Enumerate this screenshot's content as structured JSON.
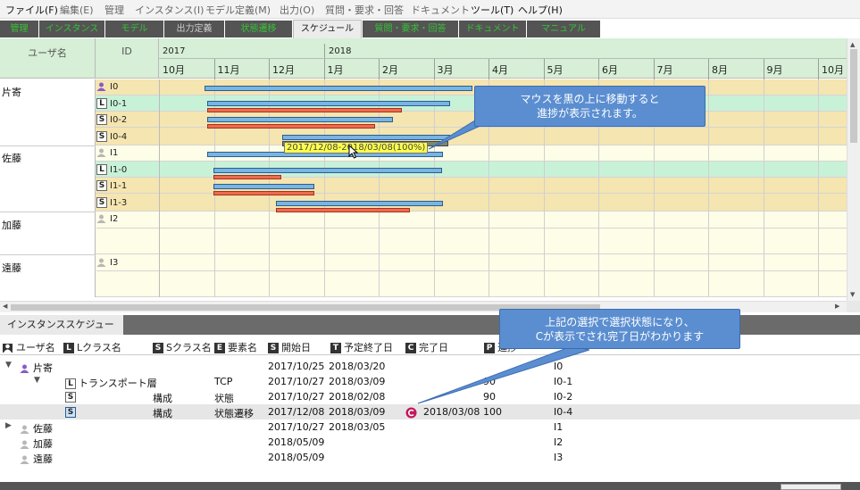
{
  "menu": [
    "ファイル(F)",
    "編集(E)",
    "管理",
    "インスタンス(I)",
    "モデル定義(M)",
    "出力(O)",
    "質問・要求・回答",
    "ドキュメント",
    "ツール(T)",
    "ヘルプ(H)"
  ],
  "tabs": [
    "管理",
    "インスタンス",
    "モデル",
    "出力定義",
    "状態遷移",
    "スケジュール",
    "質問・要求・回答",
    "ドキュメント",
    "マニュアル"
  ],
  "active_tab": "スケジュール",
  "gantt": {
    "header": {
      "user_col": "ユーザ名",
      "id_col": "ID",
      "years": [
        "2017",
        "2018"
      ],
      "months": [
        "10月",
        "11月",
        "12月",
        "1月",
        "2月",
        "3月",
        "4月",
        "5月",
        "6月",
        "7月",
        "8月",
        "9月",
        "10月"
      ]
    },
    "rows": [
      {
        "user": "片寄",
        "type": "user",
        "id": "I0"
      },
      {
        "user": "",
        "type": "L",
        "id": "I0-1"
      },
      {
        "user": "",
        "type": "S",
        "id": "I0-2"
      },
      {
        "user": "",
        "type": "S",
        "id": "I0-4"
      },
      {
        "user": "佐藤",
        "type": "user",
        "id": "I1"
      },
      {
        "user": "",
        "type": "L",
        "id": "I1-0"
      },
      {
        "user": "",
        "type": "S",
        "id": "I1-1"
      },
      {
        "user": "",
        "type": "S",
        "id": "I1-3"
      },
      {
        "user": "加藤",
        "type": "user",
        "id": "I2"
      },
      {
        "user": "遠藤",
        "type": "user",
        "id": "I3"
      }
    ],
    "tooltip": "2017/12/08-2018/03/08(100%)",
    "callout1": [
      "マウスを黒の上に移動すると",
      "進捗が表示されます。"
    ]
  },
  "bottom": {
    "tab": "インスタンススケジュール",
    "callout2": [
      "上記の選択で選択状態になり、",
      "Cが表示でされ完了日がわかります"
    ],
    "columns": [
      {
        "badge": "user",
        "label": "ユーザ名"
      },
      {
        "badge": "L",
        "label": "Lクラス名"
      },
      {
        "badge": "S",
        "label": "Sクラス名"
      },
      {
        "badge": "E",
        "label": "要素名"
      },
      {
        "badge": "S",
        "label": "開始日"
      },
      {
        "badge": "T",
        "label": "予定終了日"
      },
      {
        "badge": "C",
        "label": "完了日"
      },
      {
        "badge": "P",
        "label": "進捗"
      }
    ],
    "rows": [
      {
        "expander": "▼",
        "user": "片寄",
        "lclass": "",
        "sclass": "",
        "element": "",
        "start": "2017/10/25",
        "end": "2018/03/20",
        "done": "",
        "progress": "",
        "id": "I0"
      },
      {
        "expander": "▼",
        "user": "",
        "lclass": "トランスポート層",
        "sclass": "",
        "element": "TCP",
        "start": "2017/10/27",
        "end": "2018/03/09",
        "done": "",
        "progress": "90",
        "id": "I0-1"
      },
      {
        "expander": "",
        "user": "",
        "lclass": "",
        "sclass": "構成",
        "element": "状態",
        "start": "2017/10/27",
        "end": "2018/02/08",
        "done": "",
        "progress": "90",
        "id": "I0-2"
      },
      {
        "expander": "",
        "user": "",
        "lclass": "",
        "sclass": "構成",
        "element": "状態遷移",
        "start": "2017/12/08",
        "end": "2018/03/09",
        "done": "2018/03/08",
        "progress": "100",
        "id": "I0-4"
      },
      {
        "expander": "▶",
        "user": "佐藤",
        "lclass": "",
        "sclass": "",
        "element": "",
        "start": "2017/10/27",
        "end": "2018/03/05",
        "done": "",
        "progress": "",
        "id": "I1"
      },
      {
        "expander": "",
        "user": "加藤",
        "lclass": "",
        "sclass": "",
        "element": "",
        "start": "2018/05/09",
        "end": "",
        "done": "",
        "progress": "",
        "id": "I2"
      },
      {
        "expander": "",
        "user": "遠藤",
        "lclass": "",
        "sclass": "",
        "element": "",
        "start": "2018/05/09",
        "end": "",
        "done": "",
        "progress": "",
        "id": "I3"
      }
    ]
  },
  "colors": {
    "green_header": "#d6efd6",
    "row_green": "#c8f2d8",
    "row_yellow": "#f5e5b0",
    "row_cream": "#fefde8",
    "bar_blue": "#7ab4e2",
    "bar_red": "#ef6a4e",
    "callout": "#5b8ed0",
    "tab_text": "#35c335"
  }
}
